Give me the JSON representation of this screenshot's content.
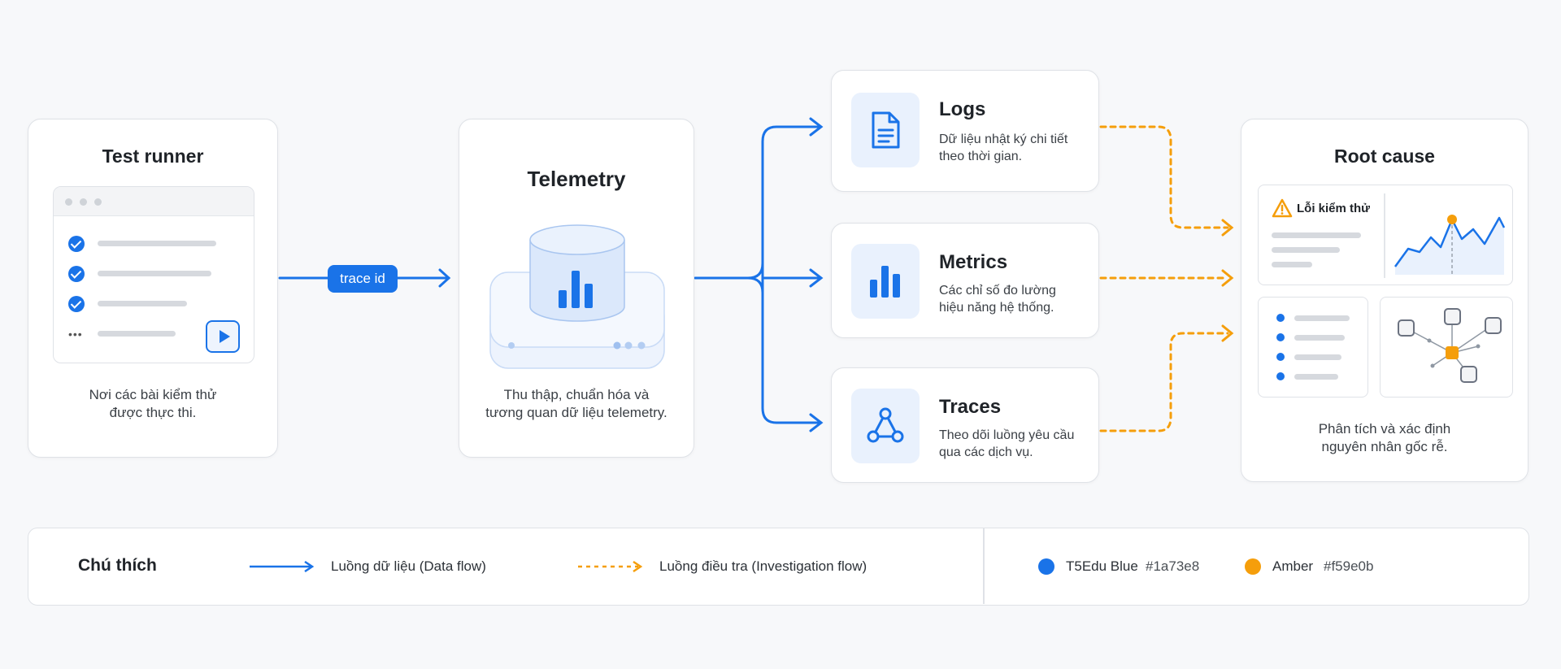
{
  "test_runner": {
    "title": "Test runner",
    "desc": "Nơi các bài kiểm thử\nđược thực thi."
  },
  "trace_label": "trace id",
  "telemetry": {
    "title": "Telemetry",
    "desc": "Thu thập, chuẩn hóa và\ntương quan dữ liệu telemetry."
  },
  "signals": [
    {
      "title": "Logs",
      "desc": "Dữ liệu nhật ký chi tiết\ntheo thời gian.",
      "icon": "document-icon"
    },
    {
      "title": "Metrics",
      "desc": "Các chỉ số đo lường\nhiệu năng hệ thống.",
      "icon": "bar-chart-icon"
    },
    {
      "title": "Traces",
      "desc": "Theo dõi luồng yêu cầu\nqua các dịch vụ.",
      "icon": "trace-graph-icon"
    }
  ],
  "root_cause": {
    "title": "Root cause",
    "error_label": "Lỗi kiểm thử",
    "desc": "Phân tích và xác định\nnguyên nhân gốc rễ."
  },
  "legend": {
    "title": "Chú thích",
    "data_flow": "Luồng dữ liệu (Data flow)",
    "investigation_flow": "Luồng điều tra (Investigation flow)",
    "colors": [
      {
        "name": "T5Edu Blue",
        "hex": "#1a73e8"
      },
      {
        "name": "Amber",
        "hex": "#f59e0b"
      }
    ]
  }
}
